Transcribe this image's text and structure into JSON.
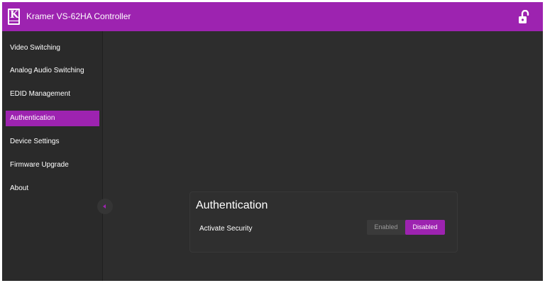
{
  "colors": {
    "accent": "#9d23b0",
    "background": "#2d2d2d",
    "sidebar": "#2a2a2a",
    "text": "#ffffff"
  },
  "header": {
    "title": "Kramer VS-62HA Controller",
    "lock_icon": "unlocked-padlock-icon"
  },
  "sidebar": {
    "items": [
      {
        "label": "Video Switching"
      },
      {
        "label": "Analog Audio Switching"
      },
      {
        "label": "EDID Management"
      },
      {
        "label": "Authentication",
        "active": true
      },
      {
        "label": "Device Settings"
      },
      {
        "label": "Firmware Upgrade"
      },
      {
        "label": "About"
      }
    ],
    "collapse_icon": "chevron-left-icon"
  },
  "panel": {
    "title": "Authentication",
    "security_label": "Activate Security",
    "toggle": {
      "enabled_label": "Enabled",
      "disabled_label": "Disabled",
      "selected": "Disabled"
    }
  }
}
